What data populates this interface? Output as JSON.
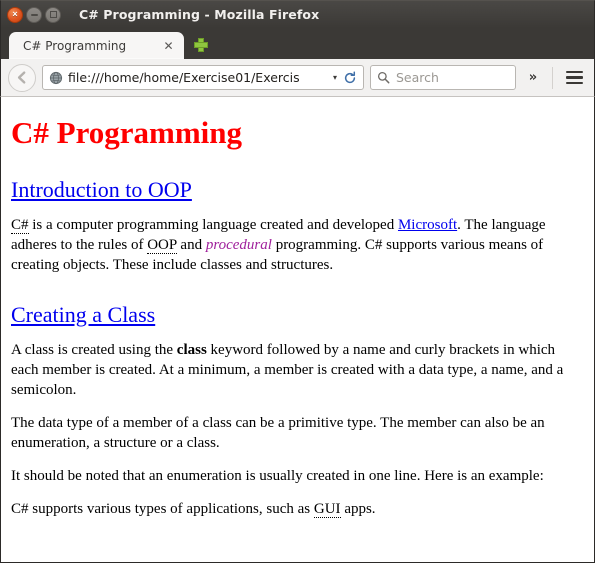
{
  "window": {
    "title": "C# Programming - Mozilla Firefox",
    "controls": {
      "close_label": "×",
      "minimize_name": "minimize",
      "maximize_name": "maximize"
    }
  },
  "tabs": {
    "items": [
      {
        "label": "C# Programming",
        "close_label": "✕",
        "active": true
      }
    ],
    "new_tab_label": "+"
  },
  "toolbar": {
    "back_name": "back-arrow-icon",
    "url_value": "file:///home/home/Exercise01/Exercis",
    "url_dropdown_label": "▾",
    "reload_label": "↻",
    "search_placeholder": "Search",
    "search_value": "",
    "overflow_label": "»",
    "menu_label": "menu"
  },
  "page": {
    "title": "C# Programming",
    "title_color": "#ff0000",
    "link_color": "#0000ee",
    "sections": [
      {
        "heading": "Introduction to OOP",
        "paragraphs": [
          {
            "parts": [
              {
                "type": "abbr",
                "text": "C#"
              },
              {
                "type": "text",
                "text": " is a computer programming language created and developed "
              },
              {
                "type": "link",
                "text": "Microsoft"
              },
              {
                "type": "text",
                "text": ". The language adheres to the rules of "
              },
              {
                "type": "abbr",
                "text": "OOP"
              },
              {
                "type": "text",
                "text": " and "
              },
              {
                "type": "emphasis",
                "text": "procedural"
              },
              {
                "type": "text",
                "text": " programming. C# supports various means of creating objects. These include classes and structures."
              }
            ]
          }
        ]
      },
      {
        "heading": "Creating a Class",
        "paragraphs": [
          {
            "parts": [
              {
                "type": "text",
                "text": "A class is created using the "
              },
              {
                "type": "strong",
                "text": "class"
              },
              {
                "type": "text",
                "text": " keyword followed by a name and curly brackets in which each member is created. At a minimum, a member is created with a data type, a name, and a semicolon."
              }
            ]
          },
          {
            "parts": [
              {
                "type": "text",
                "text": "The data type of a member of a class can be a primitive type. The member can also be an enumeration, a structure or a class."
              }
            ]
          },
          {
            "parts": [
              {
                "type": "text",
                "text": "It should be noted that an enumeration is usually created in one line. Here is an example:"
              }
            ]
          },
          {
            "parts": [
              {
                "type": "text",
                "text": "C# supports various types of applications, such as "
              },
              {
                "type": "abbr",
                "text": "GUI"
              },
              {
                "type": "text",
                "text": " apps."
              }
            ]
          }
        ]
      }
    ]
  },
  "colors": {
    "heading_red": "#ff0000",
    "link_blue": "#0000ee",
    "emphasis_purple": "#a0219c",
    "chrome_dark": "#3b3936",
    "toolbar_bg": "#f2f1f0",
    "close_button": "#df5420",
    "new_tab_green": "#8fc63f"
  }
}
